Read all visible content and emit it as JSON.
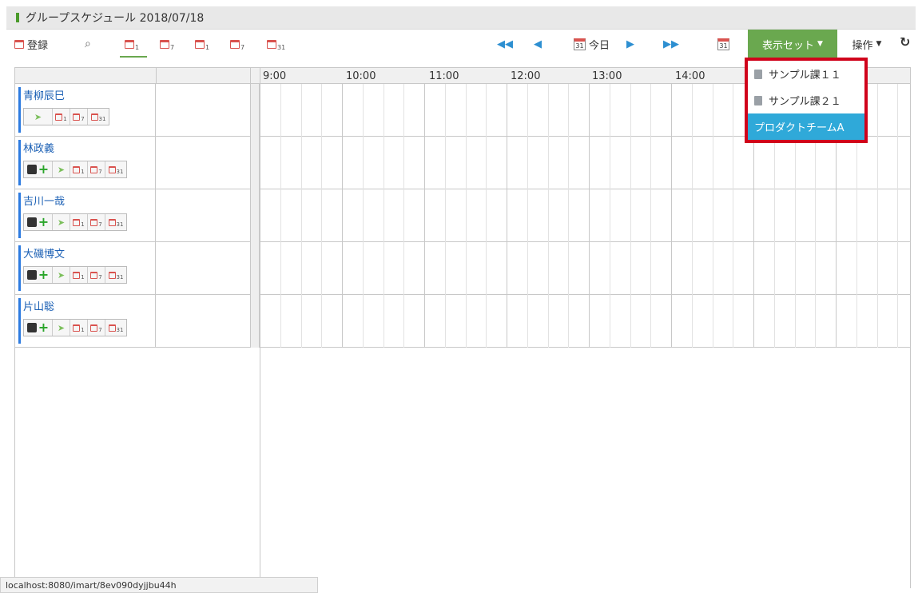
{
  "window": {
    "title": "グループスケジュール 2018/07/18"
  },
  "toolbar": {
    "register_label": "登録",
    "view_subscripts": [
      "1",
      "7",
      "1",
      "7",
      "31"
    ],
    "today_label": "今日",
    "cal_day": "31",
    "display_set_label": "表示セット",
    "operations_label": "操作",
    "refresh_icon": "↻"
  },
  "grid": {
    "hours": [
      "9:00",
      "10:00",
      "11:00",
      "12:00",
      "13:00",
      "14:00"
    ]
  },
  "users": [
    {
      "name": "青柳辰巳"
    },
    {
      "name": "林政義"
    },
    {
      "name": "吉川一哉"
    },
    {
      "name": "大磯博文"
    },
    {
      "name": "片山聡"
    }
  ],
  "user_icons": {
    "sub1": "1",
    "sub7": "7",
    "sub31": "31"
  },
  "dropdown": {
    "items": [
      "サンプル課１１",
      "サンプル課２１",
      "プロダクトチームA"
    ],
    "selected_index": 2
  },
  "statusbar": {
    "url": "localhost:8080/imart/8ev090dyjjbu44h"
  },
  "colors": {
    "accent_green": "#6aa84f",
    "highlight_blue": "#2fa9d9",
    "box_red": "#d0021b",
    "link_blue": "#1a5fb4"
  }
}
